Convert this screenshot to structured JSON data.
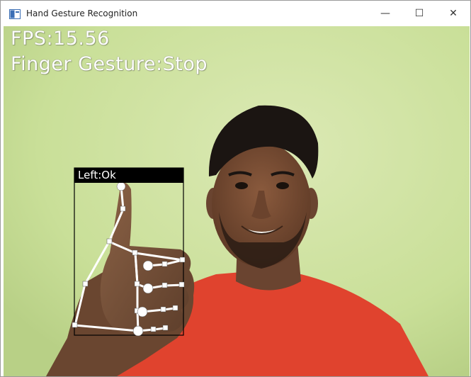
{
  "window": {
    "title": "Hand Gesture Recognition",
    "controls": {
      "minimize": "—",
      "maximize": "☐",
      "close": "✕"
    }
  },
  "overlay": {
    "fps_text": "FPS:15.56",
    "gesture_text": "Finger Gesture:Stop",
    "hand_label": "Left:Ok"
  },
  "colors": {
    "wall": "#cfe3a0",
    "shirt": "#e0432e",
    "skin": "#7d5236",
    "hair": "#1b1512",
    "landmark": "#ffffff",
    "label_bg": "#000000"
  },
  "icons": {
    "app": "app-window-icon"
  }
}
